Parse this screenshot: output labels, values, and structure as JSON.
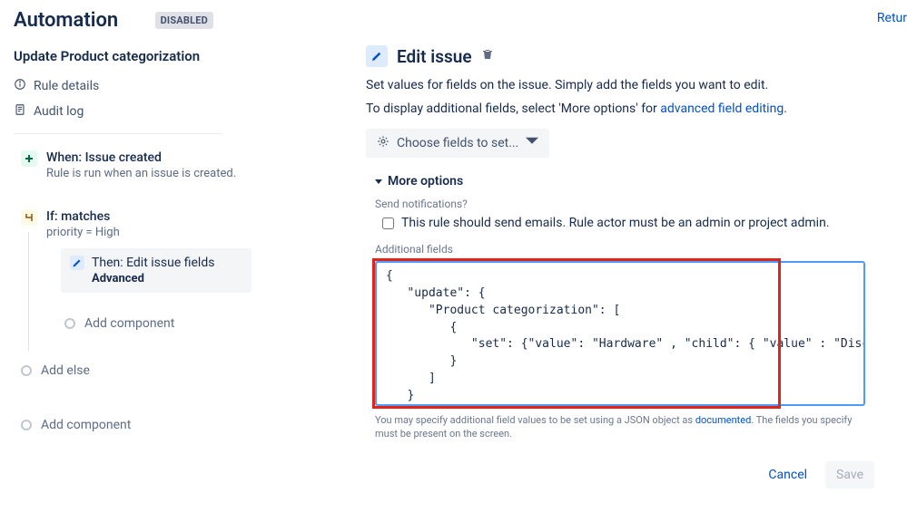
{
  "header": {
    "title": "Automation",
    "status_badge": "DISABLED",
    "return_link": "Retur"
  },
  "rule": {
    "name": "Update Product categorization",
    "meta": {
      "details": "Rule details",
      "audit_log": "Audit log"
    }
  },
  "steps": {
    "trigger": {
      "title": "When: Issue created",
      "subtitle": "Rule is run when an issue is created."
    },
    "condition": {
      "title": "If: matches",
      "subtitle": "priority = High"
    },
    "action": {
      "title": "Then: Edit issue fields",
      "subtitle": "Advanced"
    },
    "add_component": "Add component",
    "add_else": "Add else"
  },
  "panel": {
    "title": "Edit issue",
    "desc1": "Set values for fields on the issue. Simply add the fields you want to edit.",
    "desc2_pre": "To display additional fields, select 'More options' for ",
    "desc2_link": "advanced field editing",
    "choose_btn": "Choose fields to set...",
    "more_options": "More options",
    "send_notif_label": "Send notifications?",
    "send_notif_desc": "This rule should send emails. Rule actor must be an admin or project admin.",
    "additional_fields_label": "Additional fields",
    "code": "{\n   \"update\": {\n      \"Product categorization\": [\n         {\n            \"set\": {\"value\": \"Hardware\" , \"child\": { \"value\" : \"Disc\"} }\n         }\n      ]\n   }\n}",
    "help_pre": "You may specify additional field values to be set using a JSON object as ",
    "help_link": "documented",
    "help_post": ". The fields you specify must be present on the screen.",
    "cancel": "Cancel",
    "save": "Save"
  }
}
